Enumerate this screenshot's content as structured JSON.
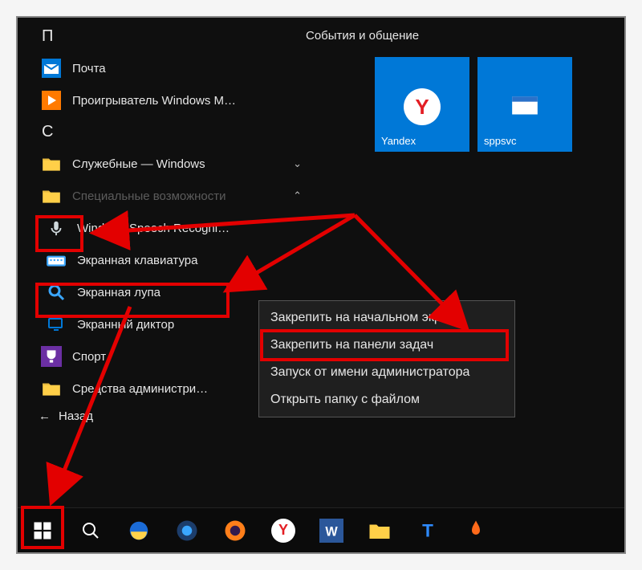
{
  "tiles_header": "События и общение",
  "letters": {
    "p": "П",
    "s": "С"
  },
  "apps": {
    "mail": "Почта",
    "wmp": "Проигрыватель Windows M…",
    "utilities": "Служебные — Windows",
    "ease_of_access": "Специальные возможности",
    "speech": "Windows Speech Recogni…",
    "osk": "Экранная клавиатура",
    "magnifier": "Экранная лупа",
    "narrator": "Экранный диктор",
    "sport": "Спорт",
    "admin_tools": "Средства администри…",
    "back": "Назад"
  },
  "tiles": {
    "yandex": "Yandex",
    "sppsvc": "sppsvc"
  },
  "context_menu": {
    "pin_start": "Закрепить на начальном экране",
    "pin_taskbar": "Закрепить на панели задач",
    "run_admin": "Запуск от имени администратора",
    "open_folder": "Открыть папку с файлом"
  }
}
